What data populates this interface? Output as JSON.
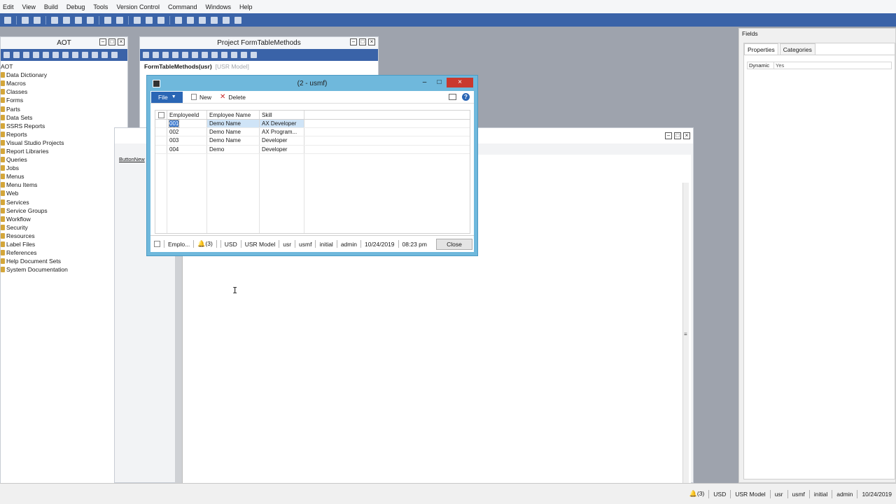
{
  "menubar": {
    "items": [
      "Edit",
      "View",
      "Build",
      "Debug",
      "Tools",
      "Version Control",
      "Command",
      "Windows",
      "Help"
    ]
  },
  "aot": {
    "title": "AOT",
    "root": "AOT",
    "items": [
      "Data Dictionary",
      "Macros",
      "Classes",
      "Forms",
      "Parts",
      "Data Sets",
      "SSRS Reports",
      "Reports",
      "Visual Studio Projects",
      "Report Libraries",
      "Queries",
      "Jobs",
      "Menus",
      "Menu Items",
      "Web",
      "Services",
      "Service Groups",
      "Workflow",
      "Security",
      "Resources",
      "Label Files",
      "References",
      "Help Document Sets",
      "System Documentation"
    ]
  },
  "project": {
    "title": "Project FormTableMethods",
    "node": "FormTableMethods(usr)",
    "model": "[USR Model]"
  },
  "editor": {
    "tree_label": "ButtonNew"
  },
  "fields": {
    "title": "Fields",
    "tabs": [
      "Properties",
      "Categories"
    ],
    "property_key": "Dynamic",
    "property_value": "Yes"
  },
  "dialog": {
    "title": "(2 - usmf)",
    "file_label": "File",
    "new_label": "New",
    "delete_label": "Delete",
    "columns": [
      "EmployeeId",
      "Employee Name",
      "Skill"
    ],
    "rows": [
      {
        "id": "001",
        "name": "Demo Name",
        "skill": "AX Developer"
      },
      {
        "id": "002",
        "name": "Demo Name",
        "skill": "AX Program..."
      },
      {
        "id": "003",
        "name": "Demo Name",
        "skill": "Developer"
      },
      {
        "id": "004",
        "name": "Demo",
        "skill": "Developer"
      }
    ],
    "status": {
      "table": "Emplo...",
      "alerts": "(3)",
      "currency": "USD",
      "model": "USR Model",
      "layer": "usr",
      "company": "usmf",
      "partition": "initial",
      "user": "admin",
      "date": "10/24/2019",
      "time": "08:23 pm"
    },
    "close_label": "Close"
  },
  "statusbar": {
    "alerts": "(3)",
    "currency": "USD",
    "model": "USR Model",
    "layer": "usr",
    "company": "usmf",
    "partition": "initial",
    "user": "admin",
    "date": "10/24/2019"
  }
}
